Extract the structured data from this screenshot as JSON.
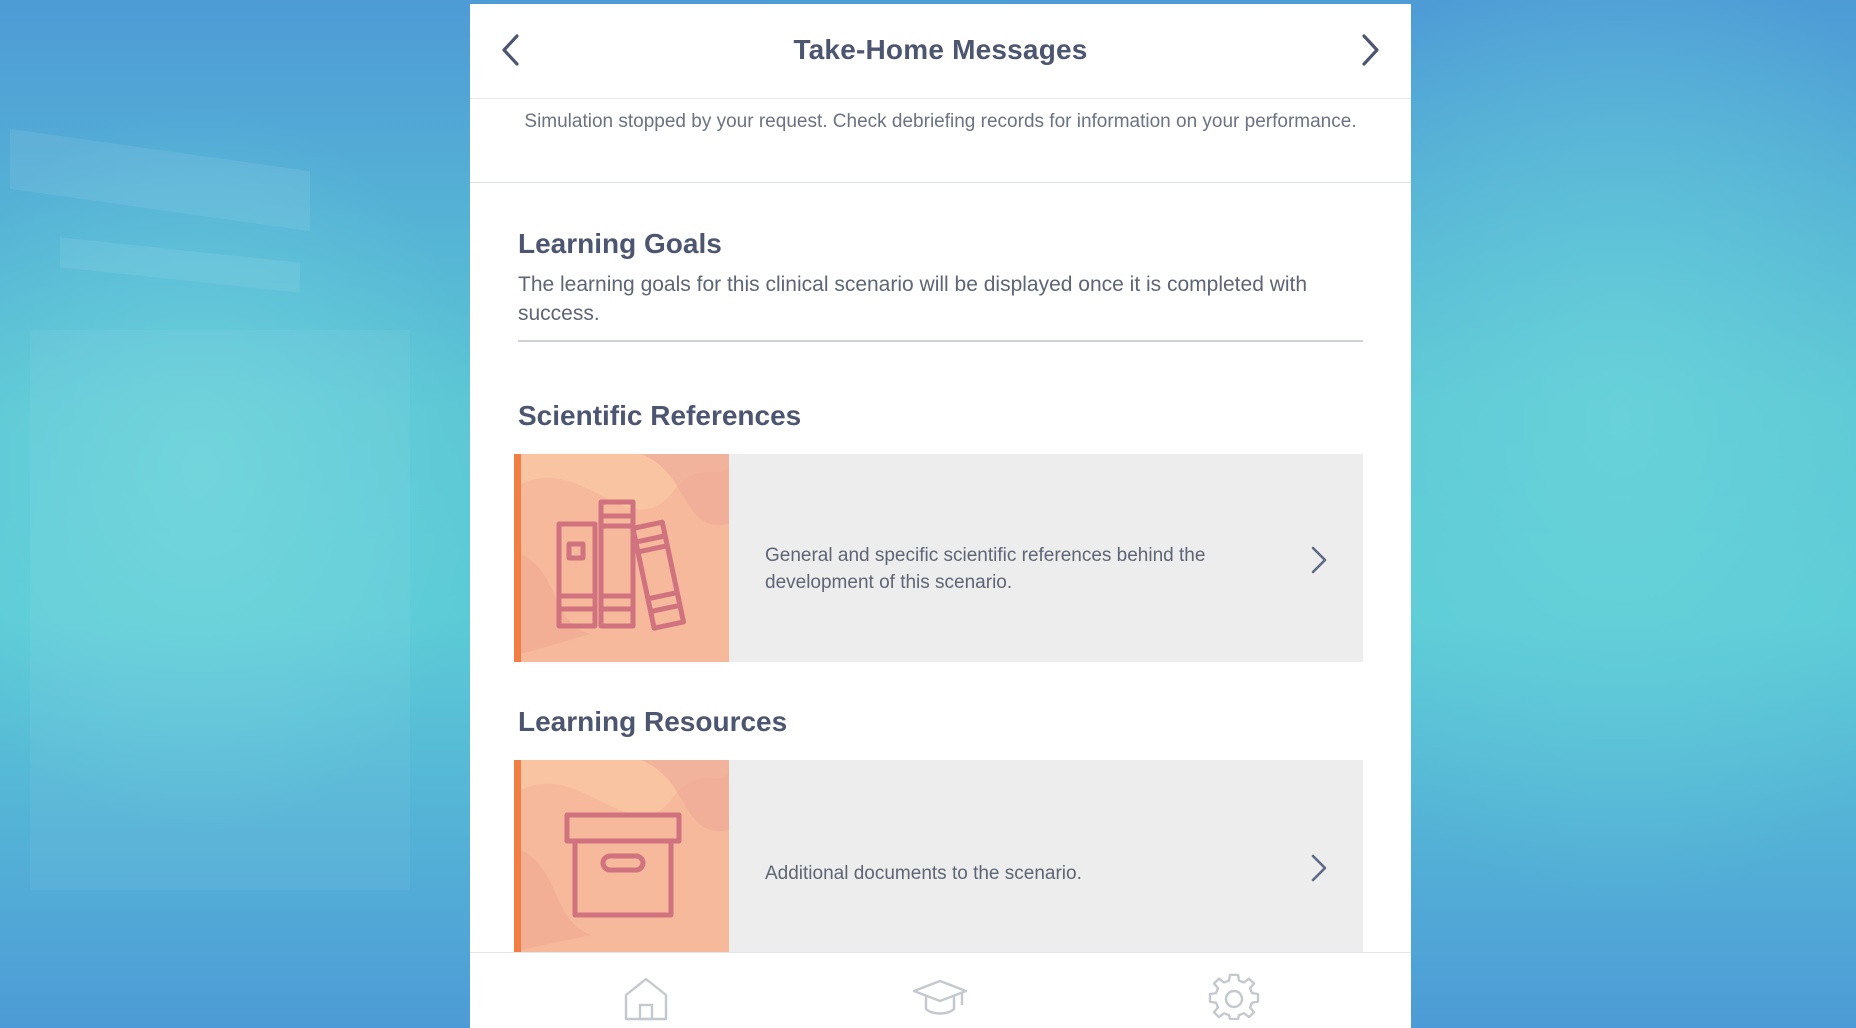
{
  "header": {
    "title": "Take-Home Messages",
    "back_icon": "chevron-left-icon",
    "forward_icon": "chevron-right-icon"
  },
  "notice": "Simulation stopped by your request. Check debriefing records for information on your performance.",
  "learning_goals": {
    "title": "Learning Goals",
    "text": "The learning goals for this clinical scenario will be displayed once it is completed with success."
  },
  "scientific_references": {
    "title": "Scientific References",
    "card": {
      "icon": "books-icon",
      "description": "General and specific scientific references behind the development of this scenario."
    }
  },
  "learning_resources": {
    "title": "Learning Resources",
    "card": {
      "icon": "archive-box-icon",
      "description": "Additional documents to the scenario."
    }
  },
  "tabbar": {
    "tabs": [
      {
        "name": "home",
        "icon": "home-icon"
      },
      {
        "name": "learning",
        "icon": "graduation-cap-icon"
      },
      {
        "name": "settings",
        "icon": "gear-icon"
      }
    ]
  },
  "colors": {
    "accent": "#f17e43",
    "card_thumb": "#f8c4a1",
    "icon_stroke": "#d1727f",
    "text_dark": "#4d5670",
    "text_body": "#5e6575"
  }
}
